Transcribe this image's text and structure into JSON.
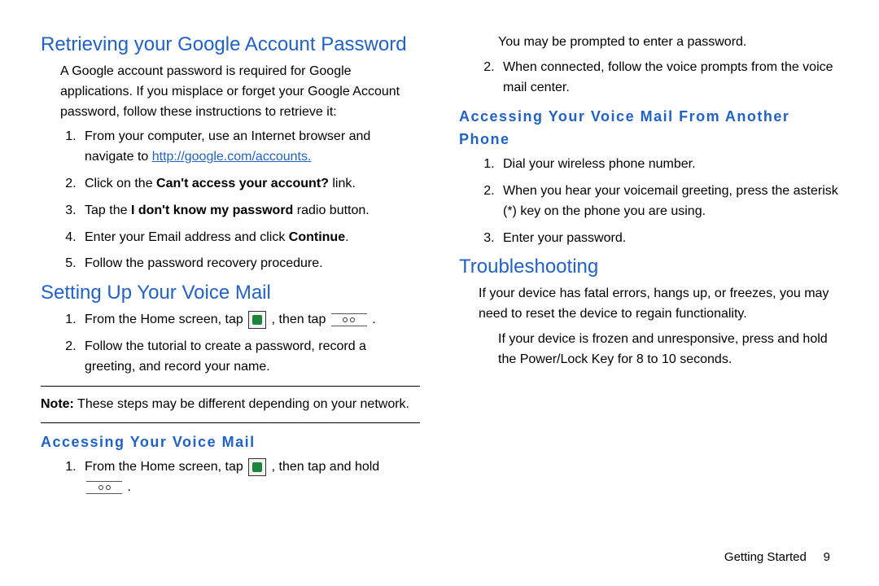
{
  "left": {
    "h1": "Retrieving your Google Account Password",
    "p1": "A Google account password is required for Google applications. If you misplace or forget your Google Account password, follow these instructions to retrieve it:",
    "list1": {
      "i1a": "From your computer, use an Internet browser and navigate to ",
      "i1_link": "http://google.com/accounts.",
      "i2a": "Click on the ",
      "i2b": "Can't access your account?",
      "i2c": " link.",
      "i3a": "Tap the ",
      "i3b": "I don't know my password",
      "i3c": " radio button.",
      "i4a": "Enter your Email address and click ",
      "i4b": "Continue",
      "i4c": ".",
      "i5": "Follow the password recovery procedure."
    },
    "h2": "Setting Up Your Voice Mail",
    "list2": {
      "i1a": "From the Home screen, tap ",
      "i1b": " , then tap ",
      "i1c": " .",
      "i2": "Follow the tutorial to create a password, record a greeting, and record your name."
    },
    "note_label": "Note:",
    "note_text": " These steps may be different depending on your network.",
    "h3": "Accessing Your Voice Mail",
    "list3": {
      "i1a": "From the Home screen, tap ",
      "i1b": " , then tap and hold",
      "i1c": " ."
    }
  },
  "right": {
    "cont_a": "You may be prompted to enter a password.",
    "cont_b": "When connected, follow the voice prompts from the voice mail center.",
    "h1": "Accessing Your Voice Mail From Another Phone",
    "list1": {
      "i1": "Dial your wireless phone number.",
      "i2": "When you hear your voicemail greeting, press the asterisk (*) key on the phone you are using.",
      "i3": "Enter your password."
    },
    "h2": "Troubleshooting",
    "p1": "If your device has fatal errors, hangs up, or freezes, you may need to reset the device to regain functionality.",
    "p2": "If your device is frozen and unresponsive, press and hold the Power/Lock Key for 8 to 10 seconds."
  },
  "footer": {
    "section": "Getting Started",
    "page": "9"
  }
}
